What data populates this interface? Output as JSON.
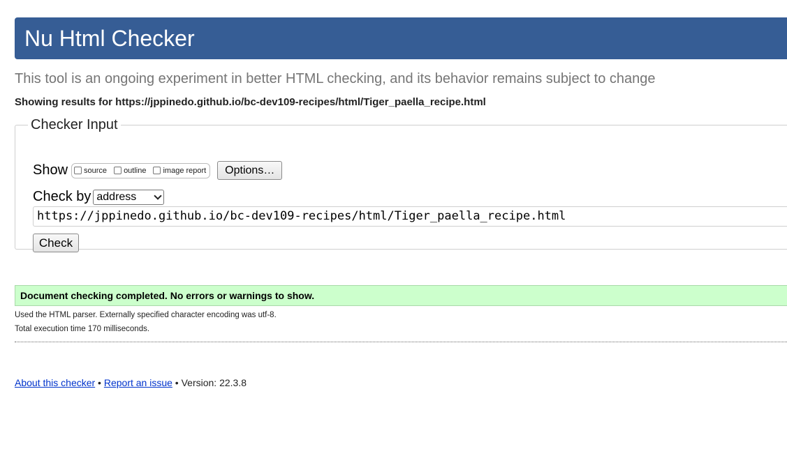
{
  "header": {
    "title": "Nu Html Checker"
  },
  "intro": {
    "subtitle": "This tool is an ongoing experiment in better HTML checking, and its behavior remains subject to change",
    "showing_results": "Showing results for https://jppinedo.github.io/bc-dev109-recipes/html/Tiger_paella_recipe.html"
  },
  "checker_input": {
    "legend": "Checker Input",
    "show_label": "Show",
    "show_options": {
      "source": "source",
      "outline": "outline",
      "image_report": "image report"
    },
    "options_button": "Options…",
    "check_by_label": "Check by",
    "check_by_selected": "address",
    "url_value": "https://jppinedo.github.io/bc-dev109-recipes/html/Tiger_paella_recipe.html",
    "check_button": "Check"
  },
  "results": {
    "success_message": "Document checking completed. No errors or warnings to show.",
    "success_bg_color": "#ccffcc",
    "parser_note": "Used the HTML parser. Externally specified character encoding was utf-8.",
    "execution_time": "Total execution time 170 milliseconds."
  },
  "footer": {
    "about_link": "About this checker",
    "separator1": " • ",
    "report_link": "Report an issue",
    "version": " • Version: 22.3.8"
  },
  "colors": {
    "banner": "#365d95",
    "link": "#0033cc"
  }
}
